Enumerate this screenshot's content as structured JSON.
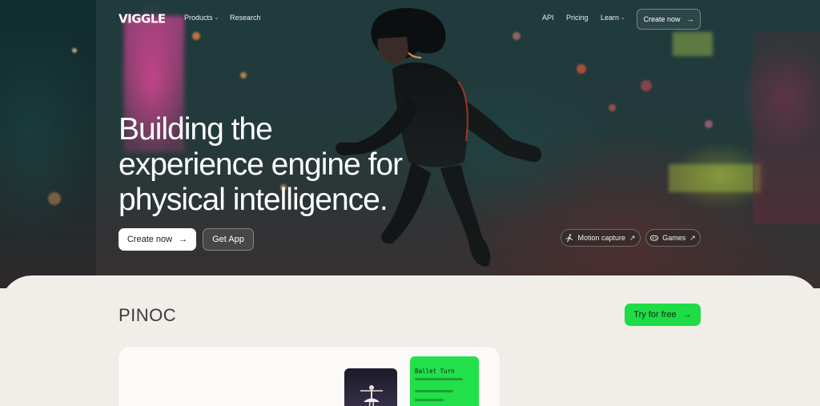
{
  "brand": {
    "logo_text": "VIGGLE"
  },
  "nav": {
    "products": "Products",
    "research": "Research",
    "api": "API",
    "pricing": "Pricing",
    "learn": "Learn",
    "create_now": "Create now"
  },
  "hero": {
    "headline_lines": [
      "Building the",
      "experience engine for",
      "physical intelligence."
    ],
    "create_now": "Create now",
    "get_app": "Get App",
    "motion_capture": "Motion capture",
    "games": "Games"
  },
  "section": {
    "title": "PINOC",
    "try_for_free": "Try for free",
    "demo_card_title": "Ballet Turn"
  },
  "colors": {
    "accent_green": "#1edc45",
    "hero_text": "#ffffff",
    "section_bg": "#f1eee9"
  },
  "icons": {
    "arrow": "arrow-right-icon",
    "diagonal_arrow": "arrow-up-right-icon",
    "chevron": "chevron-down-icon",
    "running_person": "running-person-icon",
    "gamepad": "gamepad-icon"
  }
}
